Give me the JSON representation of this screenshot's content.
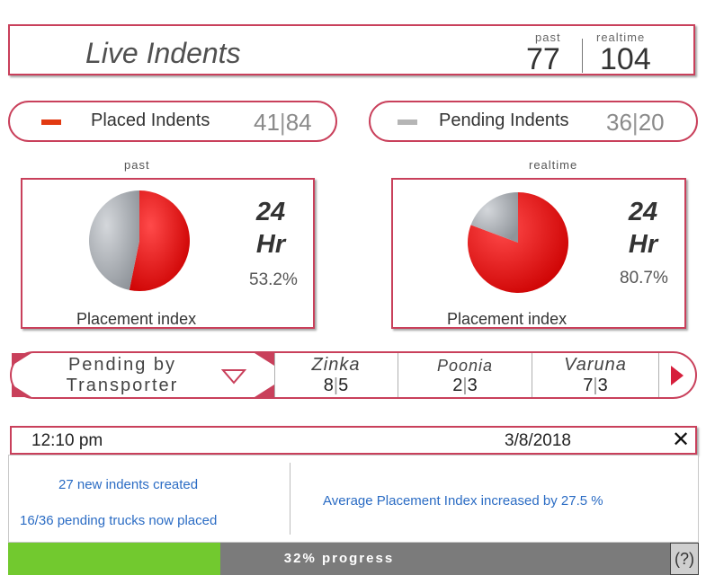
{
  "header": {
    "title": "Live Indents",
    "past_label": "past",
    "past_value": "77",
    "realtime_label": "realtime",
    "realtime_value": "104"
  },
  "legend": {
    "placed": {
      "label": "Placed Indents",
      "past": "41",
      "sep": "|",
      "realtime": "84",
      "color": "#e23a12"
    },
    "pending": {
      "label": "Pending Indents",
      "past": "36",
      "sep": "|",
      "realtime": "20",
      "color": "#b5b5b5"
    }
  },
  "charts": {
    "past": {
      "caption": "past",
      "hours": "24",
      "unit": "Hr",
      "percent_text": "53.2%",
      "label": "Placement index"
    },
    "realtime": {
      "caption": "realtime",
      "hours": "24",
      "unit": "Hr",
      "percent_text": "80.7%",
      "label": "Placement index"
    }
  },
  "chart_data": [
    {
      "type": "pie",
      "title": "",
      "labels": [
        "Placed",
        "Pending"
      ],
      "values": [
        53.2,
        46.8
      ],
      "colors": [
        "#e3050e",
        "#a6aab0"
      ]
    },
    {
      "type": "pie",
      "title": "",
      "labels": [
        "Placed",
        "Pending"
      ],
      "values": [
        80.7,
        19.3
      ],
      "colors": [
        "#e3050e",
        "#a6aab0"
      ]
    }
  ],
  "transporter": {
    "selector_line1": "Pending by",
    "selector_line2": "Transporter",
    "items": [
      {
        "name": "Zinka",
        "a": "8",
        "sep": "|",
        "b": "5"
      },
      {
        "name": "Poonia",
        "a": "2",
        "sep": "|",
        "b": "3"
      },
      {
        "name": "Varuna",
        "a": "7",
        "sep": "|",
        "b": "3"
      }
    ]
  },
  "notification": {
    "time": "12:10 pm",
    "date": "3/8/2018",
    "close": "✕",
    "line1": "27 new indents created",
    "line2": "16/36  pending trucks now placed",
    "message": "Average Placement Index increased by 27.5 %"
  },
  "progress": {
    "value": 0.32,
    "label": "32% progress",
    "help": "(?)"
  }
}
